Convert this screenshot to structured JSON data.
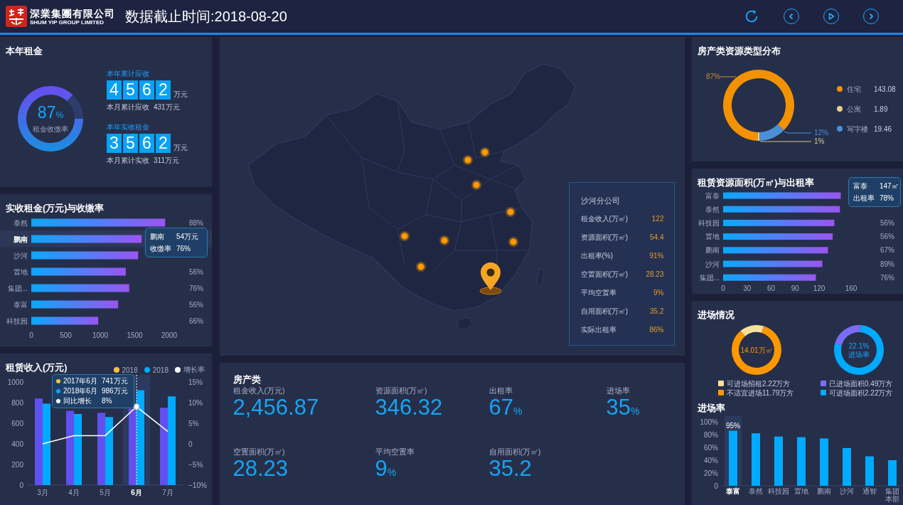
{
  "header": {
    "company_name": "深業集團有限公司",
    "company_name_en": "SHUM YIP GROUP LIMITED",
    "title": "数据截止时间:2018-08-20",
    "buttons": [
      {
        "kind": "refresh"
      },
      {
        "kind": "prev"
      },
      {
        "kind": "play"
      },
      {
        "kind": "next"
      }
    ]
  },
  "rent": {
    "title": "本年租金",
    "gauge": {
      "value": "87",
      "unit": "%",
      "label": "租金收缴率",
      "chart_data": {
        "type": "donut",
        "values": [
          87,
          13
        ]
      }
    },
    "counters": [
      {
        "label": "本年累计应收",
        "digits": [
          "4",
          "5",
          "6",
          "2"
        ],
        "unit": "万元",
        "month_label": "本月累计应收",
        "month_value": "431万元"
      },
      {
        "label": "本年实收租金",
        "digits": [
          "3",
          "5",
          "6",
          "2"
        ],
        "unit": "万元",
        "month_label": "本月累计实收",
        "month_value": "311万元"
      }
    ]
  },
  "collected": {
    "title": "实收租金(万元)与收缴率",
    "rows": [
      {
        "selected": false,
        "rate": "88%"
      },
      {
        "selected": true
      },
      {
        "selected": false
      },
      {
        "selected": false,
        "rate": "56%"
      },
      {
        "selected": false,
        "rate": "76%"
      },
      {
        "selected": false,
        "rate": "56%"
      },
      {
        "selected": false,
        "rate": "66%"
      }
    ],
    "tooltip": {
      "name": "鹏南",
      "value": "54万元",
      "label": "收缴率",
      "rate": "76%"
    },
    "chart_data": {
      "type": "bar",
      "orientation": "horizontal",
      "categories": [
        "泰然",
        "鹏南",
        "沙河",
        "置地",
        "集团...",
        "泰富",
        "科技园"
      ],
      "values": [
        1940,
        1600,
        1550,
        1370,
        1420,
        1260,
        970
      ],
      "xlim": [
        0,
        2000
      ],
      "xticks": [
        0,
        500,
        1000,
        1500,
        2000
      ]
    }
  },
  "lease_income": {
    "title": "租赁收入(万元)",
    "legend": [
      {
        "color": "#f5c242"
      },
      {
        "color": "#00aaff"
      },
      {
        "color": "#ffffff"
      }
    ],
    "columns": [
      {
        "selected": false
      },
      {
        "selected": false
      },
      {
        "selected": false
      },
      {
        "selected": true
      },
      {
        "selected": false
      }
    ],
    "tooltip": {
      "rows": [
        {
          "label": "2017年6月",
          "value": "741万元",
          "color": "#f5c242"
        },
        {
          "label": "2018年6月",
          "value": "986万元",
          "color": "#00aaff"
        },
        {
          "label": "同比增长",
          "value": "8%",
          "color": "#ffffff"
        }
      ]
    },
    "chart_data": {
      "type": "bar",
      "categories": [
        "3月",
        "4月",
        "5月",
        "6月",
        "7月"
      ],
      "series": [
        {
          "name": "2018",
          "color": "#6150f0",
          "values": [
            840,
            720,
            700,
            740,
            750
          ]
        },
        {
          "name": "2018",
          "color": "#00aaff",
          "values": [
            790,
            690,
            660,
            920,
            860
          ]
        },
        {
          "name": "增长率",
          "color": "#ffffff",
          "type": "line",
          "axis": "y2",
          "values": [
            0,
            2,
            2,
            9,
            3
          ]
        }
      ],
      "ylim": [
        0,
        1000
      ],
      "yticks": [
        0,
        200,
        400,
        600,
        800,
        1000
      ],
      "y2lim": [
        -10,
        15
      ],
      "y2ticks": [
        {
          "value": 15,
          "label": "15%"
        },
        {
          "value": 10,
          "label": "10%"
        },
        {
          "value": 5,
          "label": "5%"
        },
        {
          "value": 0,
          "label": "0"
        },
        {
          "value": -5,
          "label": "−5%"
        },
        {
          "value": -10,
          "label": "−10%"
        }
      ]
    }
  },
  "map": {
    "info": {
      "title": "沙河分公司",
      "rows": [
        {
          "label": "租金收入(万㎡)",
          "value": "122"
        },
        {
          "label": "资源面积(万㎡)",
          "value": "54.4"
        },
        {
          "label": "出租率(%)",
          "value": "91%"
        },
        {
          "label": "空置面积(万㎡)",
          "value": "28.23"
        },
        {
          "label": "平均空置率",
          "value": "9%"
        },
        {
          "label": "自用面积(万㎡)",
          "value": "35.2"
        },
        {
          "label": "实际出租率",
          "value": "86%"
        }
      ]
    }
  },
  "property_stats": {
    "title": "房产类",
    "items": [
      {
        "label": "租金收入(万元)",
        "value": "2,456.87"
      },
      {
        "label": "资源面积(万㎡)",
        "value": "346.32"
      },
      {
        "label": "出租率",
        "value": "67",
        "unit": "%"
      },
      {
        "label": "进场率",
        "value": "35",
        "unit": "%"
      },
      {
        "label": "空置面积(万㎡)",
        "value": "28.23"
      },
      {
        "label": "平均空置率",
        "value": "9",
        "unit": "%"
      },
      {
        "label": "自用面积(万㎡)",
        "value": "35.2"
      }
    ]
  },
  "resource_types": {
    "title": "房产类资源类型分布",
    "legend": [
      {
        "label": "住宅",
        "value": "143.08",
        "color": "#f39200"
      },
      {
        "label": "公寓",
        "value": "1.89",
        "color": "#e8d08f"
      },
      {
        "label": "写字楼",
        "value": "19.46",
        "color": "#4a90d9"
      }
    ],
    "chart_data": {
      "type": "donut",
      "values": [
        87,
        1,
        12
      ],
      "value_labels": [
        "87%",
        "1%",
        "12%"
      ]
    }
  },
  "lease_area": {
    "title": "租赁资源面积(万㎡)与出租率",
    "rows": [
      {
        "selected": false
      },
      {
        "selected": false
      },
      {
        "selected": false,
        "rate": "56%"
      },
      {
        "selected": false,
        "rate": "56%"
      },
      {
        "selected": false,
        "rate": "67%"
      },
      {
        "selected": false,
        "rate": "89%"
      },
      {
        "selected": false,
        "rate": "76%"
      }
    ],
    "tooltip": {
      "name": "富泰",
      "value": "147㎡",
      "label": "出租率",
      "rate": "78%"
    },
    "chart_data": {
      "type": "bar",
      "orientation": "horizontal",
      "categories": [
        "富泰",
        "泰然",
        "科技园",
        "置地",
        "鹏南",
        "沙河",
        "集团..."
      ],
      "values": [
        147,
        146,
        139,
        137,
        131,
        124,
        116
      ],
      "xlim": [
        0,
        160
      ],
      "xticks": [
        0,
        30,
        60,
        90,
        120,
        160
      ]
    }
  },
  "entry": {
    "title": "进场情况",
    "donuts": [
      {
        "center": [
          "14.01万㎡"
        ],
        "color": "#ff9800",
        "legend": [
          {
            "label": "可进场招租2.22万方",
            "color": "#f8e19a"
          },
          {
            "label": "不适宜进场11.79万方",
            "color": "#ff9800"
          }
        ],
        "chart_data": {
          "type": "donut",
          "values": [
            15.8,
            84.2
          ]
        }
      },
      {
        "center": [
          "22.1%",
          "进场率"
        ],
        "color": "#1aa3ff",
        "legend": [
          {
            "label": "已进场面积0.49万方",
            "color": "#7a6cf5"
          },
          {
            "label": "可进场面积2.22万方",
            "color": "#00aaff"
          }
        ],
        "chart_data": {
          "type": "donut",
          "values": [
            22.1,
            77.9
          ]
        }
      }
    ]
  },
  "entry_rate": {
    "title": "进场率",
    "columns": [
      {
        "selected": true
      },
      {
        "selected": false
      },
      {
        "selected": false
      },
      {
        "selected": false
      },
      {
        "selected": false
      },
      {
        "selected": false
      },
      {
        "selected": false
      },
      {
        "selected": false
      }
    ],
    "chart_data": {
      "type": "bar",
      "categories": [
        "泰富",
        "泰然",
        "科技园",
        "置地",
        "鹏南",
        "沙河",
        "通智",
        "集团本部"
      ],
      "values": [
        86,
        82,
        77,
        76,
        74,
        59,
        46,
        40
      ],
      "ylim": [
        0,
        100
      ],
      "yticks": [
        {
          "value": 0,
          "label": "0"
        },
        {
          "value": 20,
          "label": "20%"
        },
        {
          "value": 40,
          "label": "40%"
        },
        {
          "value": 60,
          "label": "60%"
        },
        {
          "value": 80,
          "label": "80%"
        },
        {
          "value": 100,
          "label": "100%"
        }
      ],
      "annotations": [
        "95%"
      ]
    }
  }
}
